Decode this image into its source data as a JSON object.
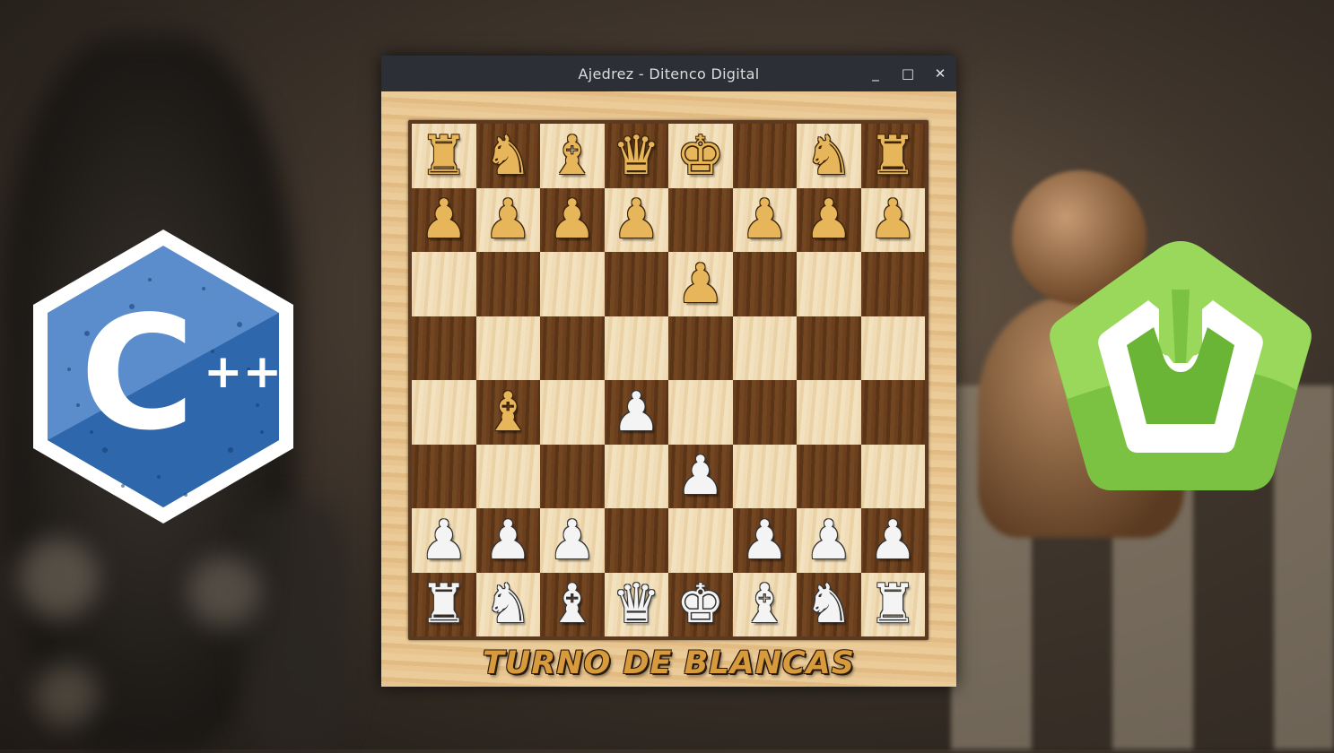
{
  "window": {
    "title": "Ajedrez - Ditenco Digital",
    "controls": {
      "minimize": "_",
      "maximize": "□",
      "close": "✕"
    }
  },
  "logos": {
    "cpp_text": "C",
    "cpp_plus": "++"
  },
  "game": {
    "turn_text": "TURNO DE BLANCAS",
    "board": [
      [
        "b:rook",
        "b:knight",
        "b:bishop",
        "b:queen",
        "b:king",
        "",
        "b:knight",
        "b:rook"
      ],
      [
        "b:pawn",
        "b:pawn",
        "b:pawn",
        "b:pawn",
        "",
        "b:pawn",
        "b:pawn",
        "b:pawn"
      ],
      [
        "",
        "",
        "",
        "",
        "b:pawn",
        "",
        "",
        ""
      ],
      [
        "",
        "",
        "",
        "",
        "",
        "",
        "",
        ""
      ],
      [
        "",
        "b:bishop",
        "",
        "w:pawn",
        "",
        "",
        "",
        ""
      ],
      [
        "",
        "",
        "",
        "",
        "w:pawn",
        "",
        "",
        ""
      ],
      [
        "w:pawn",
        "w:pawn",
        "w:pawn",
        "",
        "",
        "w:pawn",
        "w:pawn",
        "w:pawn"
      ],
      [
        "w:rook",
        "w:knight",
        "w:bishop",
        "w:queen",
        "w:king",
        "w:bishop",
        "w:knight",
        "w:rook"
      ]
    ],
    "top_left_square": "light"
  },
  "colors": {
    "black_piece": "#e7b55a",
    "white_piece": "#f4f4f4",
    "light_square": "#f0dcb6",
    "dark_square": "#6b3f1e",
    "cpp_blue": "#4a7fbf",
    "green_logo": "#7cc242"
  }
}
